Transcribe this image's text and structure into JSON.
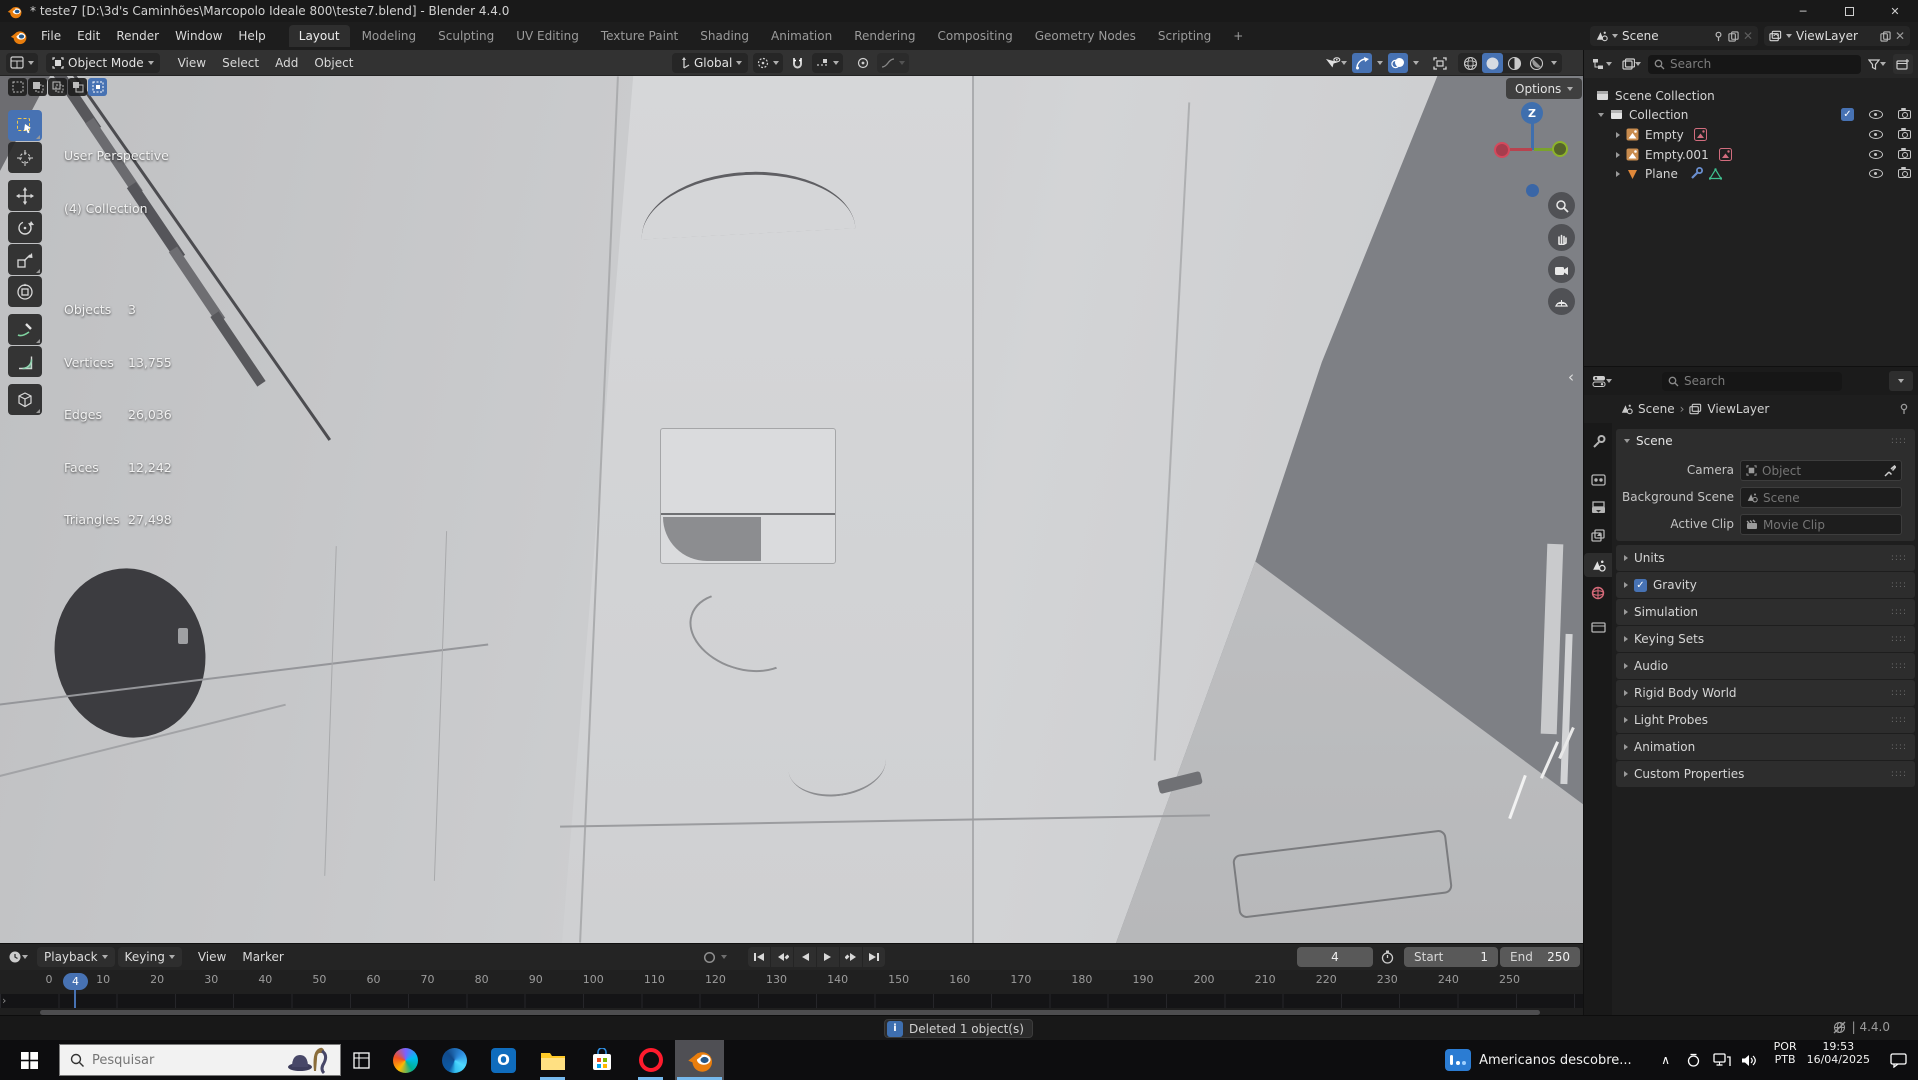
{
  "window": {
    "title": "* teste7 [D:\\3d's Caminhões\\Marcopolo Ideale 800\\teste7.blend] - Blender 4.4.0"
  },
  "colors": {
    "accent": "#4772b3",
    "blender_orange": "#e87d0d",
    "viewport_bg": "#7e8085",
    "bus_light": "#cdced0",
    "taskbar_underline": "#76b9ed"
  },
  "topbar": {
    "menus": [
      "File",
      "Edit",
      "Render",
      "Window",
      "Help"
    ],
    "tabs": [
      "Layout",
      "Modeling",
      "Sculpting",
      "UV Editing",
      "Texture Paint",
      "Shading",
      "Animation",
      "Rendering",
      "Compositing",
      "Geometry Nodes",
      "Scripting"
    ],
    "new_tab": "+",
    "active_tab": "Layout",
    "scene_field": "Scene",
    "viewlayer_field": "ViewLayer"
  },
  "viewport_header": {
    "mode": "Object Mode",
    "menus": [
      "View",
      "Select",
      "Add",
      "Object"
    ],
    "orientation": "Global",
    "options": "Options"
  },
  "viewport": {
    "overlay": {
      "view_label": "User Perspective",
      "collection_label": "(4) Collection",
      "stats": [
        {
          "label": "Objects",
          "value": "3"
        },
        {
          "label": "Vertices",
          "value": "13,755"
        },
        {
          "label": "Edges",
          "value": "26,036"
        },
        {
          "label": "Faces",
          "value": "12,242"
        },
        {
          "label": "Triangles",
          "value": "27,498"
        }
      ]
    },
    "gizmo": {
      "z_label": "Z"
    }
  },
  "outliner": {
    "search_placeholder": "Search",
    "rows": [
      {
        "label": "Scene Collection"
      },
      {
        "label": "Collection"
      },
      {
        "label": "Empty"
      },
      {
        "label": "Empty.001"
      },
      {
        "label": "Plane"
      }
    ]
  },
  "properties": {
    "search_placeholder": "Search",
    "breadcrumb": {
      "scene": "Scene",
      "viewlayer": "ViewLayer"
    },
    "scene_panel": {
      "title": "Scene",
      "camera_label": "Camera",
      "camera_placeholder": "Object",
      "bg_label": "Background Scene",
      "bg_placeholder": "Scene",
      "clip_label": "Active Clip",
      "clip_placeholder": "Movie Clip"
    },
    "sections": [
      "Units",
      "Gravity",
      "Simulation",
      "Keying Sets",
      "Audio",
      "Rigid Body World",
      "Light Probes",
      "Animation",
      "Custom Properties"
    ]
  },
  "timeline": {
    "menus": [
      "Playback",
      "Keying",
      "View",
      "Marker"
    ],
    "current_frame": "4",
    "start_label": "Start",
    "start_value": "1",
    "end_label": "End",
    "end_value": "250",
    "ruler": [
      "0",
      "10",
      "20",
      "30",
      "40",
      "50",
      "60",
      "70",
      "80",
      "90",
      "100",
      "110",
      "120",
      "130",
      "140",
      "150",
      "160",
      "170",
      "180",
      "190",
      "200",
      "210",
      "220",
      "230",
      "240",
      "250"
    ]
  },
  "statusbar": {
    "message": "Deleted 1 object(s)",
    "version": "| 4.4.0"
  },
  "taskbar": {
    "search_placeholder": "Pesquisar",
    "news_title": "Americanos descobre...",
    "lang_top": "POR",
    "lang_bottom": "PTB",
    "time": "19:53",
    "date": "16/04/2025"
  }
}
